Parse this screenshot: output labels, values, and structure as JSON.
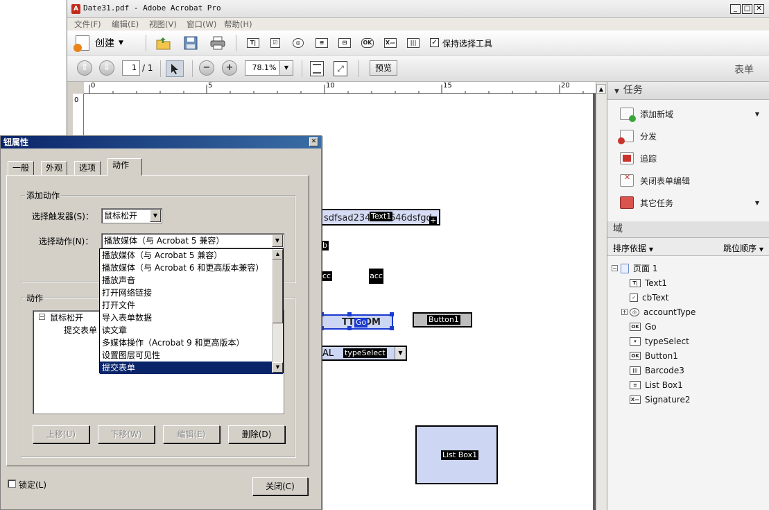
{
  "window": {
    "title": "Date31.pdf - Adobe Acrobat Pro",
    "minimize": "_",
    "maximize": "□",
    "close": "✕",
    "doc_close": "×"
  },
  "menu": [
    "文件(F)",
    "编辑(E)",
    "视图(V)",
    "窗口(W)",
    "帮助(H)"
  ],
  "toolbar1": {
    "create_label": "创建",
    "field_icons": [
      "T|",
      "☑",
      "◎",
      "≡",
      "⊟",
      "OK",
      "X—",
      "|||"
    ],
    "keep_tool_checkbox": "✓",
    "keep_tool_label": "保持选择工具"
  },
  "toolbar2": {
    "page_current": "1",
    "page_total": "/ 1",
    "zoom": "78.1%",
    "preview": "预览",
    "forms_label": "表单"
  },
  "ruler": {
    "ticks": [
      "0",
      "5",
      "10",
      "15",
      "20"
    ],
    "vtick": "0"
  },
  "document": {
    "text1_value": "sdfsad234#23646dsfgd",
    "text1_label": "Text1",
    "plus_icon": "+",
    "cb_label": "b",
    "acc_label1": "cc",
    "acc_label2": "acc",
    "go_text": "TT",
    "go_text2": "OM",
    "go_label": "Go",
    "button1_label": "Button1",
    "type_left": "AL",
    "type_select_label": "typeSelect",
    "listbox_label": "List Box1"
  },
  "tasks": {
    "header": "任务",
    "items": [
      {
        "label": "添加新域",
        "has_arrow": true
      },
      {
        "label": "分发",
        "has_arrow": false
      },
      {
        "label": "追踪",
        "has_arrow": false
      },
      {
        "label": "关闭表单编辑",
        "has_arrow": false
      },
      {
        "label": "其它任务",
        "has_arrow": true
      }
    ]
  },
  "fields": {
    "header": "域",
    "sort_label": "排序依据",
    "tab_order_label": "跳位顺序",
    "page_label": "页面 1",
    "items": [
      {
        "label": "Text1",
        "icon": "T|"
      },
      {
        "label": "cbText",
        "icon": "✓"
      },
      {
        "label": "accountType",
        "icon": "◎"
      },
      {
        "label": "Go",
        "icon": "OK"
      },
      {
        "label": "typeSelect",
        "icon": "▾"
      },
      {
        "label": "Button1",
        "icon": "OK"
      },
      {
        "label": "Barcode3",
        "icon": "|||"
      },
      {
        "label": "List Box1",
        "icon": "≡"
      },
      {
        "label": "Signature2",
        "icon": "X—"
      }
    ]
  },
  "dialog": {
    "title": "钮属性",
    "tabs": [
      "一般",
      "外观",
      "选项",
      "动作"
    ],
    "active_tab": "动作",
    "add_action_group": "添加动作",
    "trigger_label": "选择触发器(S)：",
    "trigger_value": "鼠标松开",
    "action_label": "选择动作(N)：",
    "action_value": "播放媒体（与 Acrobat 5 兼容）",
    "actions_group": "动作",
    "tree_parent": "鼠标松开",
    "tree_child": "提交表单",
    "buttons": {
      "up": "上移(U)",
      "down": "下移(W)",
      "edit": "编辑(E)",
      "delete": "删除(D)"
    },
    "lock_label": "锁定(L)",
    "close_label": "关闭(C)",
    "dropdown_options": [
      "播放媒体（与 Acrobat 5 兼容）",
      "播放媒体（与 Acrobat 6 和更高版本兼容）",
      "播放声音",
      "打开网络链接",
      "打开文件",
      "导入表单数据",
      "读文章",
      "多媒体操作（Acrobat 9 和更高版本）",
      "设置图层可见性",
      "提交表单"
    ],
    "dropdown_selected": "提交表单"
  }
}
